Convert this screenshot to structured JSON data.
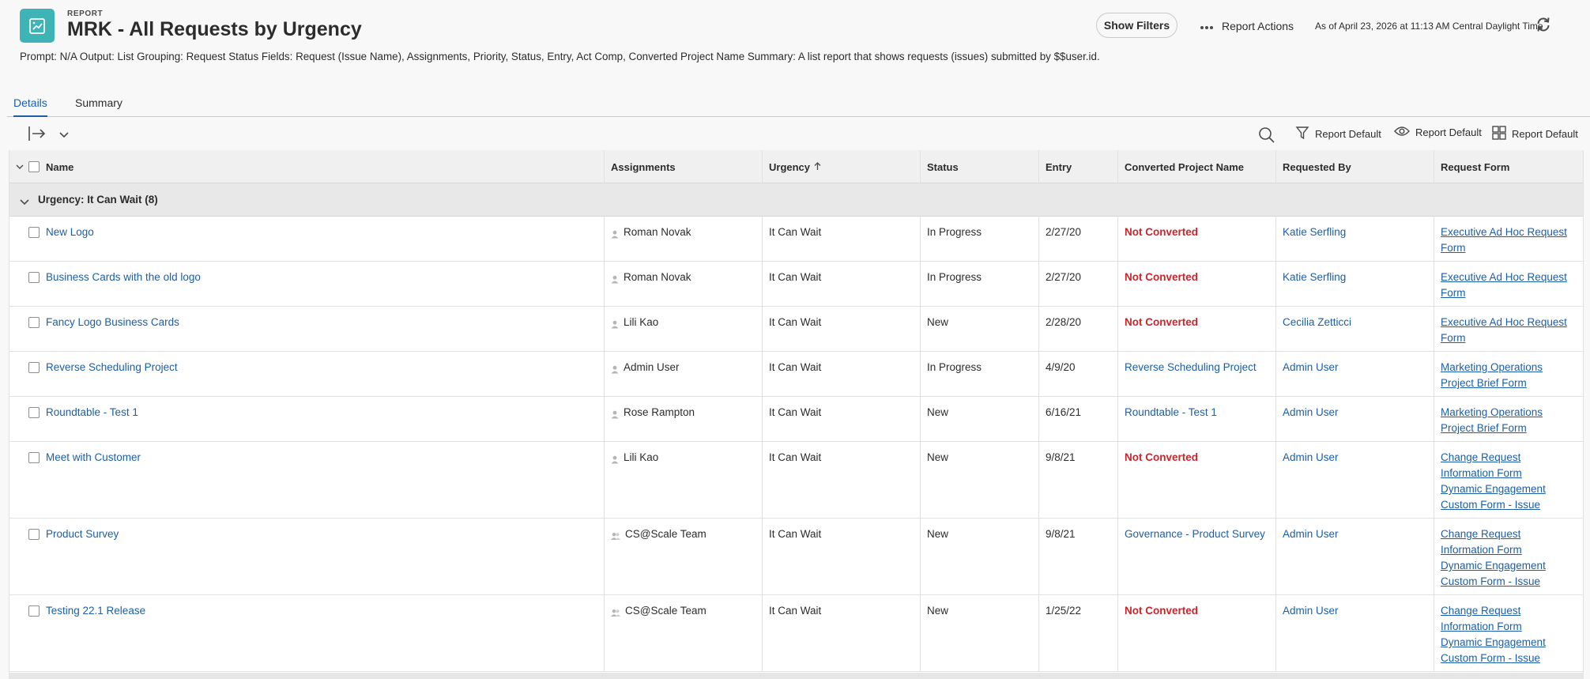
{
  "header": {
    "kicker": "REPORT",
    "title": "MRK - All Requests by Urgency",
    "show_filters_label": "Show Filters",
    "report_actions_label": "Report Actions",
    "as_of": "As of April 23, 2026 at 11:13 AM Central Daylight Time",
    "icon_color": "#3fb4b6"
  },
  "prompt_line": "Prompt: N/A Output: List Grouping: Request Status Fields: Request (Issue Name), Assignments, Priority, Status, Entry, Act Comp, Converted Project Name Summary: A list report that shows requests (issues) submitted by $$user.id.",
  "tabs": [
    {
      "label": "Details",
      "active": true
    },
    {
      "label": "Summary",
      "active": false
    }
  ],
  "toolbar": {
    "filter_label": "Report Default",
    "view_label": "Report Default",
    "grouping_label": "Report Default"
  },
  "columns": [
    "Name",
    "Assignments",
    "Urgency",
    "Status",
    "Entry",
    "Converted Project Name",
    "Requested By",
    "Request Form"
  ],
  "group": {
    "label": "Urgency: It Can Wait (8)"
  },
  "rows": [
    {
      "name": "New Logo",
      "assignment": "Roman Novak",
      "assign_type": "user",
      "urgency": "It Can Wait",
      "status": "In Progress",
      "entry": "2/27/20",
      "converted": "Not Converted",
      "converted_flag": true,
      "requested_by": "Katie Serfling",
      "form_lines": [
        "Executive Ad Hoc Request",
        "Form"
      ]
    },
    {
      "name": "Business Cards with the old logo",
      "assignment": "Roman Novak",
      "assign_type": "user",
      "urgency": "It Can Wait",
      "status": "In Progress",
      "entry": "2/27/20",
      "converted": "Not Converted",
      "converted_flag": true,
      "requested_by": "Katie Serfling",
      "form_lines": [
        "Executive Ad Hoc Request",
        "Form"
      ]
    },
    {
      "name": "Fancy Logo Business Cards",
      "assignment": "Lili Kao",
      "assign_type": "user",
      "urgency": "It Can Wait",
      "status": "New",
      "entry": "2/28/20",
      "converted": "Not Converted",
      "converted_flag": true,
      "requested_by": "Cecilia Zetticci",
      "form_lines": [
        "Executive Ad Hoc Request",
        "Form"
      ]
    },
    {
      "name": "Reverse Scheduling Project",
      "assignment": "Admin User",
      "assign_type": "user",
      "urgency": "It Can Wait",
      "status": "In Progress",
      "entry": "4/9/20",
      "converted": "Reverse Scheduling Project",
      "converted_flag": false,
      "requested_by": "Admin User",
      "form_lines": [
        "Marketing Operations",
        "Project Brief Form"
      ]
    },
    {
      "name": "Roundtable - Test 1",
      "assignment": "Rose Rampton",
      "assign_type": "user",
      "urgency": "It Can Wait",
      "status": "New",
      "entry": "6/16/21",
      "converted": "Roundtable - Test 1",
      "converted_flag": false,
      "requested_by": "Admin User",
      "form_lines": [
        "Marketing Operations",
        "Project Brief Form"
      ]
    },
    {
      "name": "Meet with Customer",
      "assignment": "Lili Kao",
      "assign_type": "user",
      "urgency": "It Can Wait",
      "status": "New",
      "entry": "9/8/21",
      "converted": "Not Converted",
      "converted_flag": true,
      "requested_by": "Admin User",
      "form_lines": [
        "Change Request",
        "Information Form",
        "Dynamic Engagement",
        "Custom Form - Issue"
      ]
    },
    {
      "name": "Product Survey",
      "assignment": "CS@Scale Team",
      "assign_type": "team",
      "urgency": "It Can Wait",
      "status": "New",
      "entry": "9/8/21",
      "converted": "Governance - Product Survey",
      "converted_flag": false,
      "requested_by": "Admin User",
      "form_lines": [
        "Change Request",
        "Information Form",
        "Dynamic Engagement",
        "Custom Form - Issue"
      ]
    },
    {
      "name": "Testing 22.1 Release",
      "assignment": "CS@Scale Team",
      "assign_type": "team",
      "urgency": "It Can Wait",
      "status": "New",
      "entry": "1/25/22",
      "converted": "Not Converted",
      "converted_flag": true,
      "requested_by": "Admin User",
      "form_lines": [
        "Change Request",
        "Information Form",
        "Dynamic Engagement",
        "Custom Form - Issue"
      ]
    }
  ],
  "colors": {
    "link": "#1c5fa8",
    "not_converted": "#c9252d",
    "accent": "#3fb4b6"
  }
}
